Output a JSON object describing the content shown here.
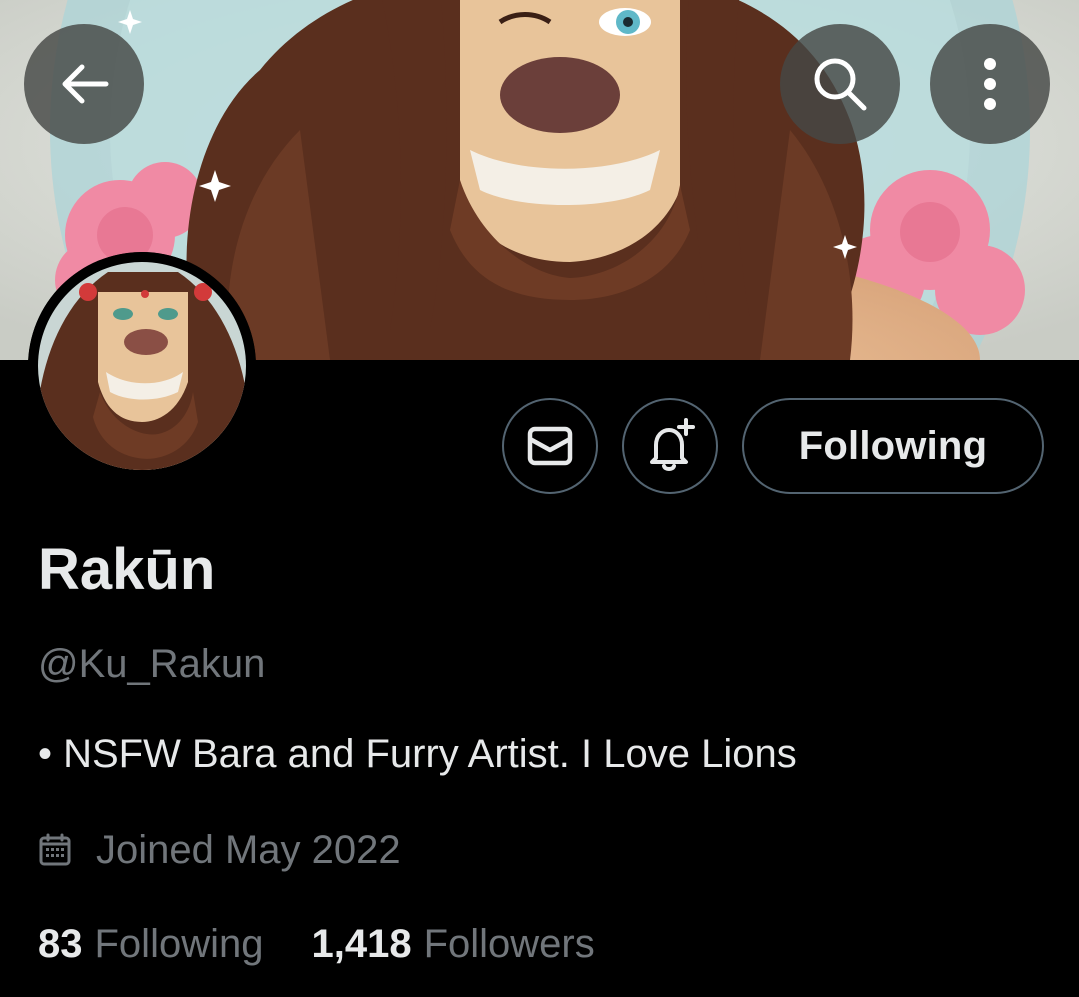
{
  "colors": {
    "background": "#000000",
    "primary_text": "#e7e9ea",
    "secondary_text": "#71767b",
    "button_border": "#536471"
  },
  "header": {
    "back_icon": "arrow-left-icon",
    "search_icon": "search-icon",
    "more_icon": "more-vertical-icon"
  },
  "actions": {
    "message_icon": "mail-icon",
    "notify_icon": "bell-plus-icon",
    "following_label": "Following"
  },
  "profile": {
    "display_name": "Rakūn",
    "handle": "@Ku_Rakun",
    "bio": "• NSFW Bara and Furry Artist. I Love Lions",
    "joined_icon": "calendar-icon",
    "joined": "Joined May 2022"
  },
  "stats": {
    "following_count": "83",
    "following_label": "Following",
    "followers_count": "1,418",
    "followers_label": "Followers"
  }
}
